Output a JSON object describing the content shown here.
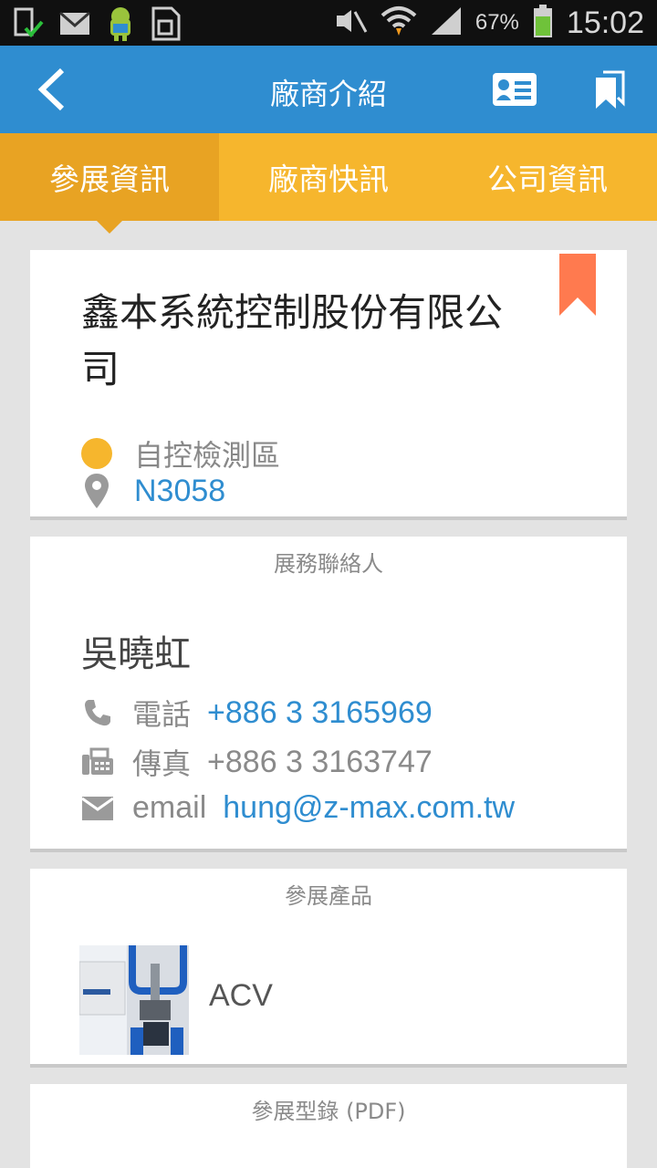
{
  "status_bar": {
    "battery_percent": "67%",
    "time": "15:02"
  },
  "app_bar": {
    "title": "廠商介紹"
  },
  "tabs": [
    {
      "label": "參展資訊",
      "active": true
    },
    {
      "label": "廠商快訊",
      "active": false
    },
    {
      "label": "公司資訊",
      "active": false
    }
  ],
  "company": {
    "name": "鑫本系統控制股份有限公司",
    "area": "自控檢測區",
    "booth": "N3058"
  },
  "contact": {
    "section_label": "展務聯絡人",
    "name": "吳曉虹",
    "phone_label": "電話",
    "phone": "+886 3 3165969",
    "fax_label": "傳真",
    "fax": "+886 3 3163747",
    "email_label": "email",
    "email": "hung@z-max.com.tw"
  },
  "products": {
    "section_label": "參展產品",
    "items": [
      {
        "name": "ACV"
      }
    ]
  },
  "catalog": {
    "section_label": "參展型錄 (PDF)"
  },
  "colors": {
    "primary": "#2f8dd0",
    "accent": "#f6b62d",
    "ribbon": "#ff7a4f"
  }
}
